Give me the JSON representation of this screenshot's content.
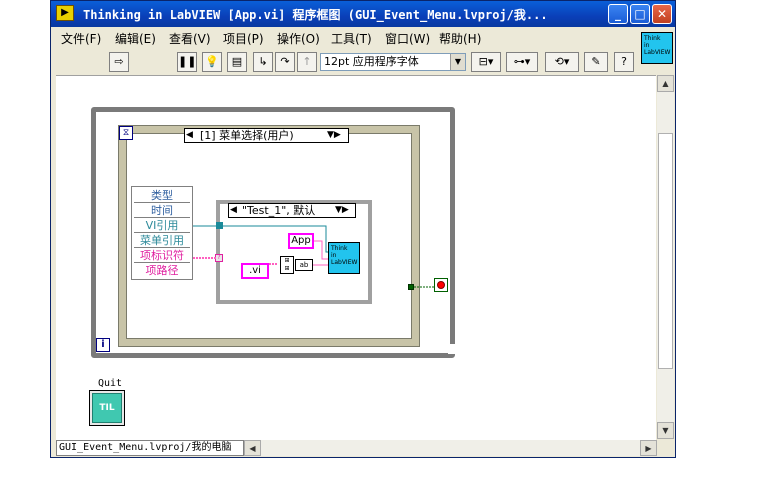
{
  "window": {
    "title": "Thinking in LabVIEW [App.vi] 程序框图 (GUI_Event_Menu.lvproj/我...",
    "app_icon": "labview-icon",
    "controls": {
      "minimize": "_",
      "maximize": "□",
      "close": "✕"
    }
  },
  "menu": {
    "items": [
      "文件(F)",
      "编辑(E)",
      "查看(V)",
      "项目(P)",
      "操作(O)",
      "工具(T)",
      "窗口(W)",
      "帮助(H)"
    ]
  },
  "toolbar": {
    "font_select": "12pt 应用程序字体",
    "help_label": "?",
    "vi_icon_lines": [
      "Think",
      "in",
      "LabVIEW"
    ]
  },
  "diagram": {
    "while_loop_stop_icon": "stop-icon",
    "case_structure_selector": "[1] 菜单选择(用户)",
    "inner_case_selector": "\"Test_1\", 默认",
    "event_data": [
      "类型",
      "时间",
      "VI引用",
      "菜单引用",
      "项标识符",
      "项路径"
    ],
    "app_constant": "App",
    "vi_constant": ".vi",
    "think_icon_lines": [
      "Think",
      "in",
      "LabVIEW"
    ],
    "iteration_label": "i",
    "quit_label": "Quit",
    "quit_icon_text": "TIL"
  },
  "status": {
    "path": "GUI_Event_Menu.lvproj/我的电脑"
  },
  "colors": {
    "title_blue": "#0a4fc8",
    "loop_gray": "#808080",
    "event_border": "#c8c8b4",
    "wire_pink": "#ff60c0",
    "wire_teal": "#1a8a9a",
    "string_pink": "#ff00ff",
    "stop_red": "#ff0000"
  }
}
